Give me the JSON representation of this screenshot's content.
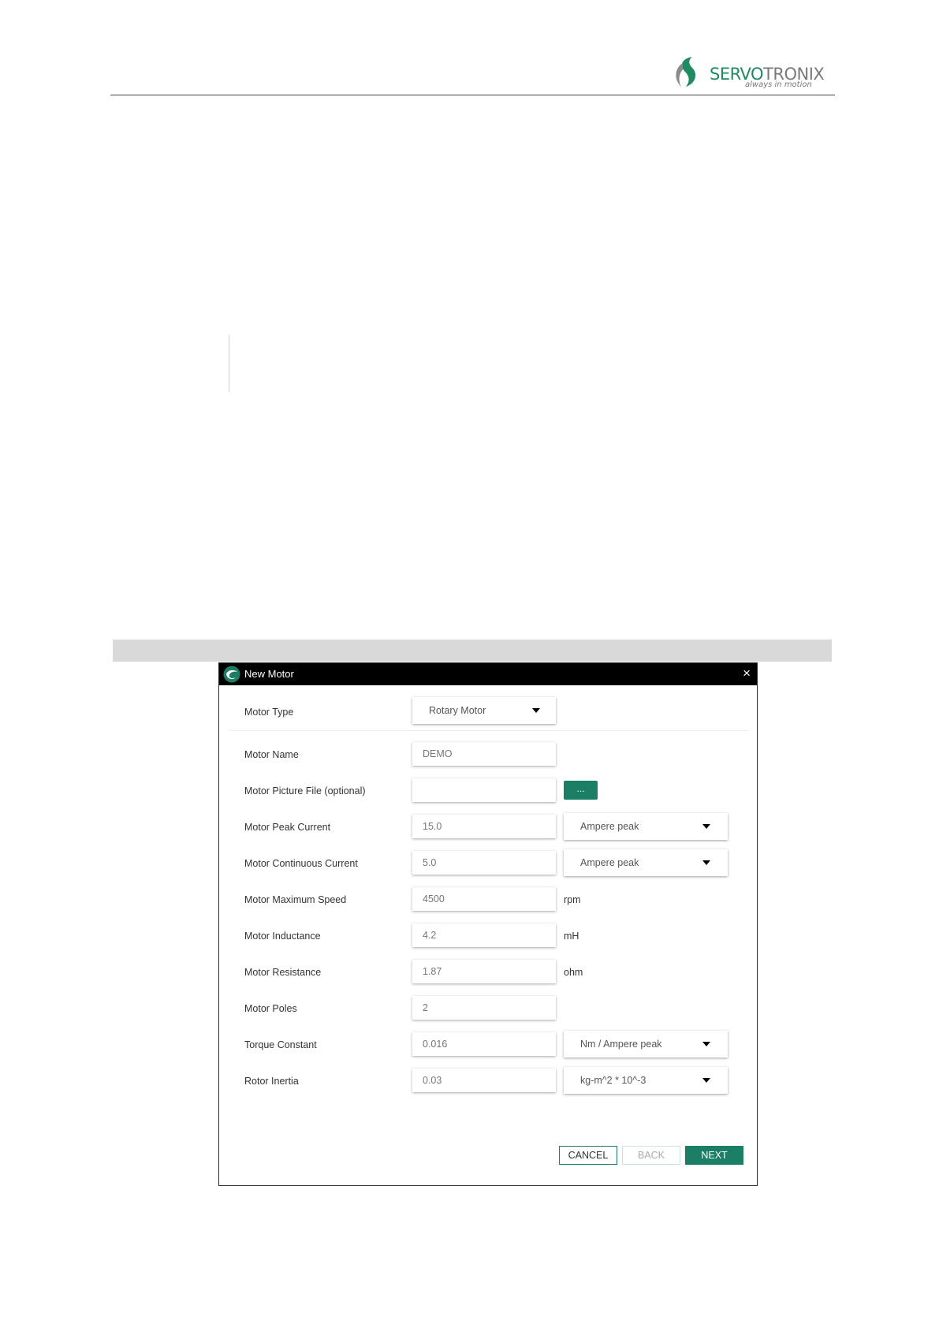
{
  "header": {
    "logo_word_green": "SERVO",
    "logo_word_gray": "TRONIX",
    "logo_tagline": "always in motion"
  },
  "dialog": {
    "title": "New Motor",
    "close_glyph": "×",
    "motor_type": {
      "label": "Motor Type",
      "value": "Rotary Motor"
    },
    "motor_name": {
      "label": "Motor Name",
      "value": "DEMO"
    },
    "motor_picture": {
      "label": "Motor Picture File (optional)",
      "value": "",
      "browse_label": "..."
    },
    "peak_current": {
      "label": "Motor Peak Current",
      "value": "15.0",
      "unit": "Ampere peak"
    },
    "continuous_current": {
      "label": "Motor Continuous Current",
      "value": "5.0",
      "unit": "Ampere peak"
    },
    "max_speed": {
      "label": "Motor Maximum Speed",
      "value": "4500",
      "unit": "rpm"
    },
    "inductance": {
      "label": "Motor Inductance",
      "value": "4.2",
      "unit": "mH"
    },
    "resistance": {
      "label": "Motor Resistance",
      "value": "1.87",
      "unit": "ohm"
    },
    "poles": {
      "label": "Motor Poles",
      "value": "2"
    },
    "torque_constant": {
      "label": "Torque Constant",
      "value": "0.016",
      "unit": "Nm / Ampere peak"
    },
    "rotor_inertia": {
      "label": "Rotor Inertia",
      "value": "0.03",
      "unit": "kg-m^2 * 10^-3"
    },
    "buttons": {
      "cancel": "CANCEL",
      "back": "BACK",
      "next": "NEXT"
    }
  },
  "colors": {
    "accent": "#1a7f64",
    "logo_green": "#1e8c61",
    "logo_gray": "#7a7a7a",
    "titlebar": "#000000"
  }
}
